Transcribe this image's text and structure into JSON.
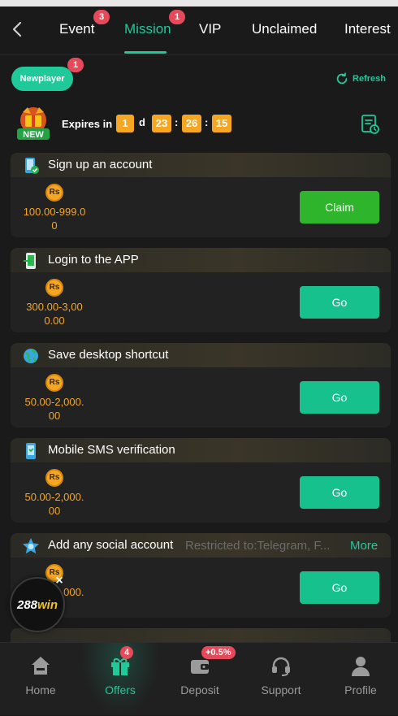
{
  "tabs": {
    "items": [
      {
        "label": "Event",
        "badge": "3"
      },
      {
        "label": "Mission",
        "badge": "1",
        "active": true
      },
      {
        "label": "VIP"
      },
      {
        "label": "Unclaimed"
      },
      {
        "label": "Interest"
      }
    ]
  },
  "filter": {
    "chip_label": "Newplayer",
    "chip_badge": "1",
    "refresh_label": "Refresh"
  },
  "expiry": {
    "label": "Expires in",
    "days": "1",
    "day_unit": "d",
    "hours": "23",
    "minutes": "26",
    "seconds": "15",
    "sep": ":"
  },
  "new_badge_text": "NEW",
  "currency_symbol": "Rs",
  "missions": [
    {
      "title": "Sign up an account",
      "reward": "100.00-999.00",
      "button": "Claim"
    },
    {
      "title": "Login to the APP",
      "reward": "300.00-3,000.00",
      "button": "Go"
    },
    {
      "title": "Save desktop shortcut",
      "reward": "50.00-2,000.00",
      "button": "Go"
    },
    {
      "title": "Mobile SMS verification",
      "reward": "50.00-2,000.00",
      "button": "Go"
    },
    {
      "title": "Add any social account",
      "restriction": "Restricted to:Telegram, F...",
      "more": "More",
      "reward": "50.00-2,000.00",
      "button": "Go"
    }
  ],
  "floating_logo": {
    "text_a": "288",
    "text_b": "win",
    "close": "×"
  },
  "bottom_nav": {
    "items": [
      {
        "label": "Home"
      },
      {
        "label": "Offers",
        "badge": "4",
        "active": true
      },
      {
        "label": "Deposit",
        "badge": "+0.5%"
      },
      {
        "label": "Support"
      },
      {
        "label": "Profile"
      }
    ]
  },
  "colors": {
    "accent": "#1fc99a",
    "gold": "#f5a623",
    "badge": "#e64a5a",
    "claim": "#2fb52b"
  }
}
